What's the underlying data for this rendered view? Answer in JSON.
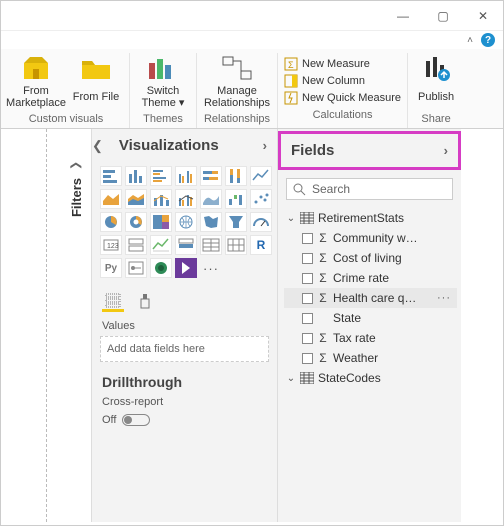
{
  "window_controls": {
    "min": "—",
    "max": "▢",
    "close": "✕"
  },
  "ribbon": {
    "groups": [
      {
        "label": "Custom visuals",
        "buttons": [
          {
            "name": "from-marketplace",
            "label": "From\nMarketplace"
          },
          {
            "name": "from-file",
            "label": "From\nFile"
          }
        ]
      },
      {
        "label": "Themes",
        "buttons": [
          {
            "name": "switch-theme",
            "label": "Switch\nTheme ▾"
          }
        ]
      },
      {
        "label": "Relationships",
        "buttons": [
          {
            "name": "manage-relationships",
            "label": "Manage\nRelationships"
          }
        ]
      },
      {
        "label": "Calculations",
        "small": [
          {
            "name": "new-measure",
            "label": "New Measure"
          },
          {
            "name": "new-column",
            "label": "New Column"
          },
          {
            "name": "new-quick-measure",
            "label": "New Quick Measure"
          }
        ]
      },
      {
        "label": "Share",
        "buttons": [
          {
            "name": "publish",
            "label": "Publish"
          }
        ]
      }
    ]
  },
  "filters_pane": {
    "label": "Filters"
  },
  "viz_pane": {
    "title": "Visualizations",
    "values_label": "Values",
    "drop_placeholder": "Add data fields here",
    "drill_label": "Drillthrough",
    "cross_label": "Cross-report",
    "off_label": "Off"
  },
  "fields_pane": {
    "title": "Fields",
    "search_placeholder": "Search",
    "tables": [
      {
        "name": "RetirementStats",
        "expanded": true,
        "fields": [
          {
            "label": "Community w…",
            "sigma": true
          },
          {
            "label": "Cost of living",
            "sigma": true
          },
          {
            "label": "Crime rate",
            "sigma": true
          },
          {
            "label": "Health care q…",
            "sigma": true,
            "hover": true
          },
          {
            "label": "State",
            "sigma": false
          },
          {
            "label": "Tax rate",
            "sigma": true
          },
          {
            "label": "Weather",
            "sigma": true
          }
        ]
      },
      {
        "name": "StateCodes",
        "expanded": false,
        "fields": []
      }
    ]
  }
}
